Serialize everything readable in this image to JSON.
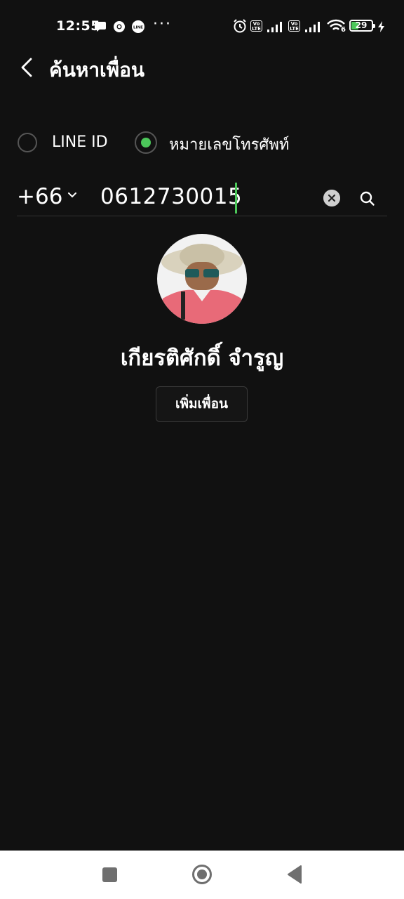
{
  "status_bar": {
    "time": "12:55",
    "battery_level": "29",
    "network_badge": "6",
    "volte_label": "Vo LTE",
    "icons": [
      "chat-icon",
      "chrome-icon",
      "line-icon",
      "more-dots-icon",
      "alarm-icon",
      "volte-icon",
      "signal-icon",
      "volte-icon",
      "signal-icon",
      "wifi-icon",
      "battery-icon",
      "charging-icon"
    ]
  },
  "header": {
    "title": "ค้นหาเพื่อน",
    "back_icon": "back-arrow-icon"
  },
  "search_type": {
    "options": [
      {
        "label": "LINE ID",
        "selected": false
      },
      {
        "label": "หมายเลขโทรศัพท์",
        "selected": true
      }
    ],
    "accent": "#4cc75a"
  },
  "search": {
    "country_code": "+66",
    "value": "0612730015",
    "clear_icon": "clear-icon",
    "search_icon": "search-icon"
  },
  "result": {
    "name": "เกียรติศักดิ์ จำรูญ",
    "add_button_label": "เพิ่มเพื่อน"
  },
  "colors": {
    "background": "#111111",
    "accent_green": "#4cc75a",
    "nav_bar": "#ffffff"
  },
  "nav_bar": {
    "icons": [
      "recent-apps-icon",
      "home-icon",
      "back-icon"
    ]
  }
}
